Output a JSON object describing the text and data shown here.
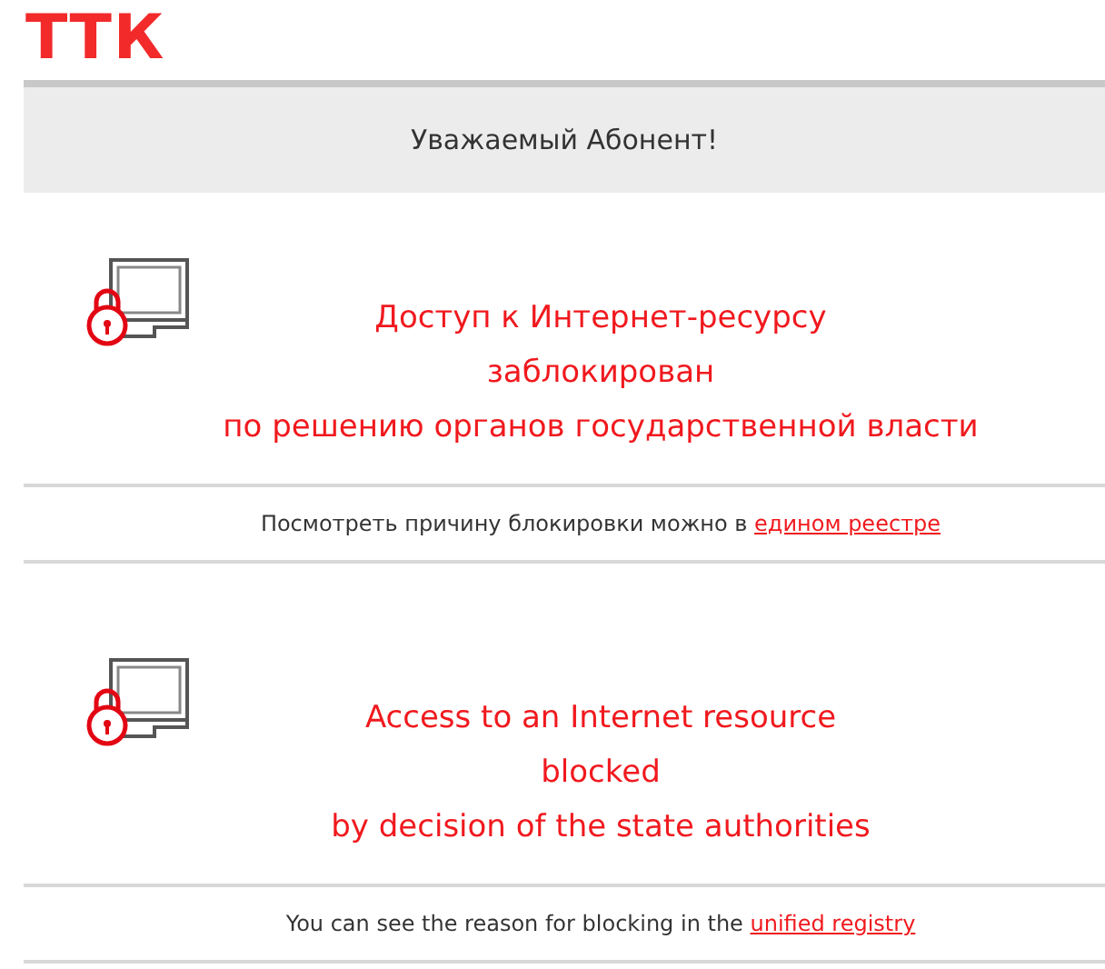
{
  "logo": "ТТК",
  "greeting": "Уважаемый Абонент!",
  "sections": [
    {
      "heading": [
        "Доступ к Интернет-ресурсу",
        "заблокирован",
        "по решению органов государственной власти"
      ],
      "note": "Посмотреть причину блокировки можно в ",
      "link": "едином реестре"
    },
    {
      "heading": [
        "Access to an Internet resource",
        "blocked",
        "by decision of the state authorities"
      ],
      "note": "You can see the reason for blocking in the ",
      "link": "unified registry"
    }
  ]
}
